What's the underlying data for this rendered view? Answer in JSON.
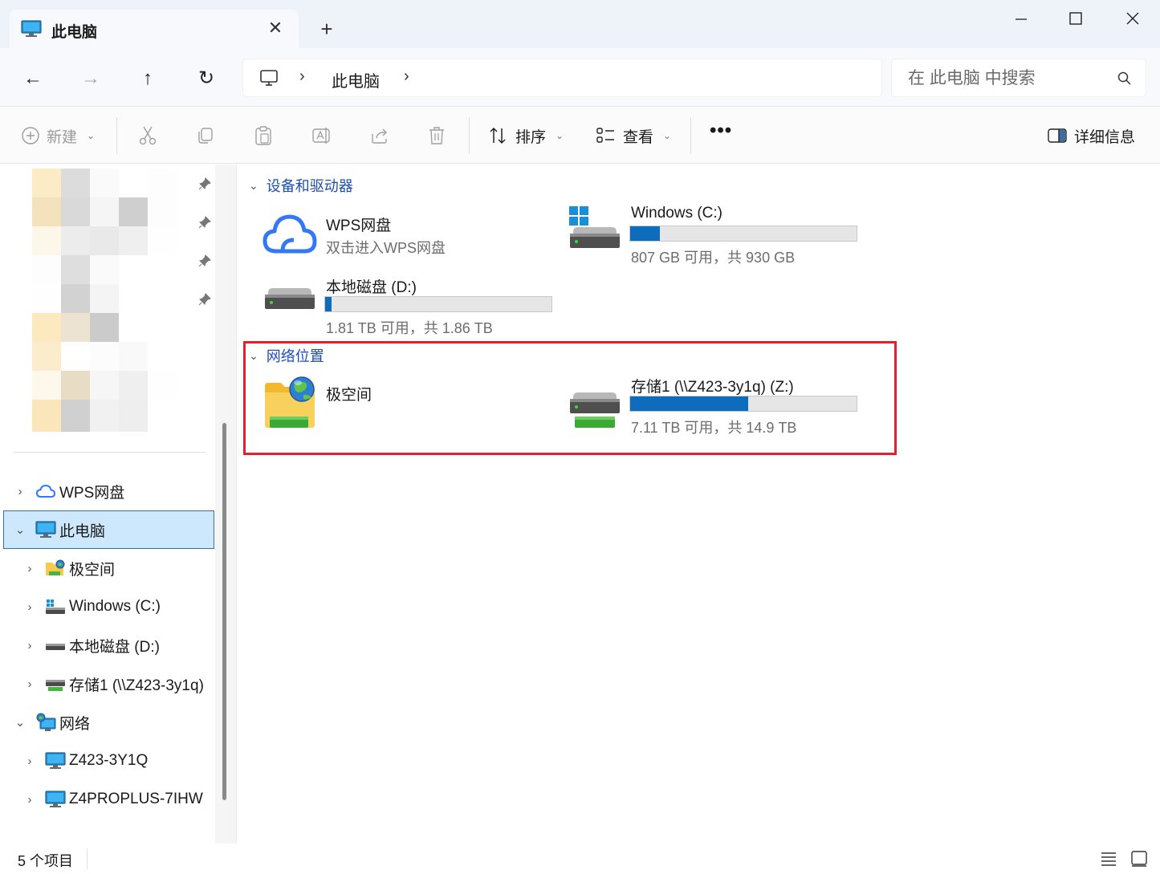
{
  "window": {
    "tab_title": "此电脑",
    "tab_close": "✕",
    "new_tab": "+"
  },
  "nav": {
    "back": "←",
    "forward": "→",
    "up": "↑",
    "refresh": "↻",
    "breadcrumb_sep": "›",
    "breadcrumb": [
      "此电脑"
    ],
    "search_placeholder": "在 此电脑 中搜索"
  },
  "toolbar": {
    "new_label": "新建",
    "sort_label": "排序",
    "view_label": "查看",
    "more_label": "•••",
    "details_label": "详细信息"
  },
  "sidebar": {
    "tree": [
      {
        "label": "WPS网盘",
        "icon": "cloud-icon",
        "expanded": false,
        "level": 0
      },
      {
        "label": "此电脑",
        "icon": "computer-icon",
        "expanded": true,
        "level": 0,
        "selected": true
      },
      {
        "label": "极空间",
        "icon": "network-folder-icon",
        "expanded": false,
        "level": 1
      },
      {
        "label": "Windows (C:)",
        "icon": "windows-drive-icon",
        "expanded": false,
        "level": 1
      },
      {
        "label": "本地磁盘 (D:)",
        "icon": "drive-icon",
        "expanded": false,
        "level": 1
      },
      {
        "label": "存储1 (\\\\Z423-3y1q)",
        "icon": "network-drive-icon",
        "expanded": false,
        "level": 1
      },
      {
        "label": "网络",
        "icon": "network-icon",
        "expanded": true,
        "level": 0
      },
      {
        "label": "Z423-3Y1Q",
        "icon": "computer-icon",
        "expanded": false,
        "level": 1
      },
      {
        "label": "Z4PROPLUS-7IHW",
        "icon": "computer-icon",
        "expanded": false,
        "level": 1
      }
    ]
  },
  "content": {
    "groups": [
      {
        "title": "设备和驱动器",
        "items": [
          {
            "name": "WPS网盘",
            "subtitle": "双击进入WPS网盘",
            "icon": "cloud-icon"
          },
          {
            "name": "Windows (C:)",
            "subtitle": "807 GB 可用，共 930 GB",
            "used_fraction": 0.13,
            "icon": "windows-drive-icon"
          },
          {
            "name": "本地磁盘 (D:)",
            "subtitle": "1.81 TB 可用，共 1.86 TB",
            "used_fraction": 0.027,
            "icon": "drive-icon"
          }
        ]
      },
      {
        "title": "网络位置",
        "items": [
          {
            "name": "极空间",
            "icon": "network-folder-icon"
          },
          {
            "name": "存储1 (\\\\Z423-3y1q) (Z:)",
            "subtitle": "7.11 TB 可用，共 14.9 TB",
            "used_fraction": 0.52,
            "icon": "network-drive-icon"
          }
        ]
      }
    ]
  },
  "status": {
    "item_count": "5 个项目"
  },
  "colors": {
    "accent": "#0f6cbd",
    "highlight_box": "#e3202c",
    "selection": "#cde8fc",
    "group_header": "#1e4db3"
  }
}
